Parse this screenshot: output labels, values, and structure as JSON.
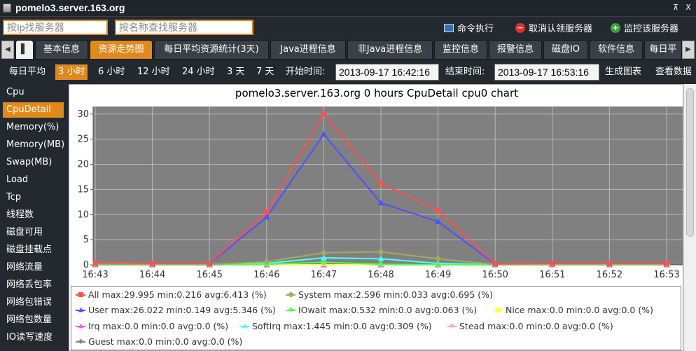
{
  "window": {
    "title": "pomelo3.server.163.org",
    "pin_label": "⊼",
    "close_label": "X"
  },
  "search": {
    "ip_placeholder": "按Ip找服务器",
    "name_placeholder": "按名称查找服务器"
  },
  "actions": [
    {
      "label": "命令执行",
      "icon": "terminal-icon",
      "color": "#3a6fb5"
    },
    {
      "label": "取消认领服务器",
      "icon": "minus-circle-icon",
      "color": "#d9342b"
    },
    {
      "label": "监控该服务器",
      "icon": "plus-circle-icon",
      "color": "#3aa43a"
    }
  ],
  "tabs": [
    {
      "label": "▌"
    },
    {
      "label": "基本信息"
    },
    {
      "label": "资源走势图",
      "active": true
    },
    {
      "label": "每日平均资源统计(3天)"
    },
    {
      "label": "Java进程信息"
    },
    {
      "label": "非Java进程信息"
    },
    {
      "label": "监控信息"
    },
    {
      "label": "报警信息"
    },
    {
      "label": "磁盘IO"
    },
    {
      "label": "软件信息"
    },
    {
      "label": "每日平"
    }
  ],
  "ranges": [
    {
      "label": "每日平均"
    },
    {
      "label": "3 小时",
      "active": true
    },
    {
      "label": "6 小时"
    },
    {
      "label": "12 小时"
    },
    {
      "label": "24 小时"
    },
    {
      "label": "3 天"
    },
    {
      "label": "7 天"
    }
  ],
  "datetime": {
    "start_label": "开始时间:",
    "start_value": "2013-09-17 16:42:16",
    "end_label": "结束时间:",
    "end_value": "2013-09-17 16:53:16",
    "generate_label": "生成图表",
    "view_label": "查看数据"
  },
  "sidebar": [
    {
      "label": "Cpu"
    },
    {
      "label": "CpuDetail",
      "active": true
    },
    {
      "label": "Memory(%)"
    },
    {
      "label": "Memory(MB)"
    },
    {
      "label": "Swap(MB)"
    },
    {
      "label": "Load"
    },
    {
      "label": "Tcp"
    },
    {
      "label": "线程数"
    },
    {
      "label": "磁盘可用"
    },
    {
      "label": "磁盘挂载点"
    },
    {
      "label": "网络流量"
    },
    {
      "label": "网络丢包率"
    },
    {
      "label": "网络包错误"
    },
    {
      "label": "网络包数量"
    },
    {
      "label": "IO读写速度"
    }
  ],
  "chart_data": {
    "type": "line",
    "title": "pomelo3.server.163.org 0 hours CpuDetail cpu0 chart",
    "x": [
      "16:43",
      "16:44",
      "16:45",
      "16:46",
      "16:47",
      "16:48",
      "16:49",
      "16:50",
      "16:51",
      "16:52",
      "16:53"
    ],
    "ylim": [
      0,
      31.5
    ],
    "yticks": [
      0,
      5,
      10,
      15,
      20,
      25,
      30
    ],
    "grid": true,
    "plot_background": "#808080",
    "legend_position": "bottom",
    "series": [
      {
        "name": "All",
        "color": "#ff5050",
        "marker": "square",
        "legend": "All max:29.995 min:0.216 avg:6.413 (%)",
        "values": [
          0.4,
          0.3,
          0.3,
          10.5,
          30.0,
          16.2,
          10.8,
          0.2,
          0.3,
          0.3,
          0.3
        ]
      },
      {
        "name": "System",
        "color": "#a8a860",
        "marker": "circle",
        "legend": "System max:2.596 min:0.033 avg:0.695 (%)",
        "values": [
          0.1,
          0.05,
          0.05,
          0.6,
          2.4,
          2.6,
          1.2,
          0.05,
          0.05,
          0.05,
          0.05
        ]
      },
      {
        "name": "User",
        "color": "#5050ff",
        "marker": "triangle",
        "legend": "User max:26.022 min:0.149 avg:5.346 (%)",
        "values": [
          0.2,
          0.2,
          0.2,
          9.5,
          26.0,
          12.3,
          8.6,
          0.15,
          0.2,
          0.2,
          0.2
        ]
      },
      {
        "name": "IOwait",
        "color": "#50ff50",
        "marker": "diamond",
        "legend": "IOwait max:0.532 min:0.0 avg:0.063 (%)",
        "values": [
          0.0,
          0.0,
          0.0,
          0.1,
          0.5,
          0.1,
          0.0,
          0.0,
          0.0,
          0.0,
          0.0
        ]
      },
      {
        "name": "Nice",
        "color": "#ffff50",
        "marker": "dash",
        "legend": "Nice max:0.0 min:0.0 avg:0.0 (%)",
        "values": [
          0,
          0,
          0,
          0,
          0,
          0,
          0,
          0,
          0,
          0,
          0
        ]
      },
      {
        "name": "Irq",
        "color": "#ff50ff",
        "marker": "triangle",
        "legend": "Irq max:0.0 min:0.0 avg:0.0 (%)",
        "values": [
          0,
          0,
          0,
          0,
          0,
          0,
          0,
          0,
          0,
          0,
          0
        ]
      },
      {
        "name": "SoftIrq",
        "color": "#50ffff",
        "marker": "triangle",
        "legend": "SoftIrq max:1.445 min:0.0 avg:0.309 (%)",
        "values": [
          0.0,
          0.0,
          0.0,
          0.3,
          1.4,
          1.2,
          0.3,
          0.0,
          0.0,
          0.0,
          0.0
        ]
      },
      {
        "name": "Stead",
        "color": "#ffafaf",
        "marker": "diamond",
        "legend": "Stead max:0.0 min:0.0 avg:0.0 (%)",
        "values": [
          0,
          0,
          0,
          0,
          0,
          0,
          0,
          0,
          0,
          0,
          0
        ]
      },
      {
        "name": "Guest",
        "color": "#808080",
        "marker": "plus",
        "legend": "Guest max:0.0 min:0.0 avg:0.0 (%)",
        "values": [
          0,
          0,
          0,
          0,
          0,
          0,
          0,
          0,
          0,
          0,
          0
        ]
      }
    ]
  }
}
